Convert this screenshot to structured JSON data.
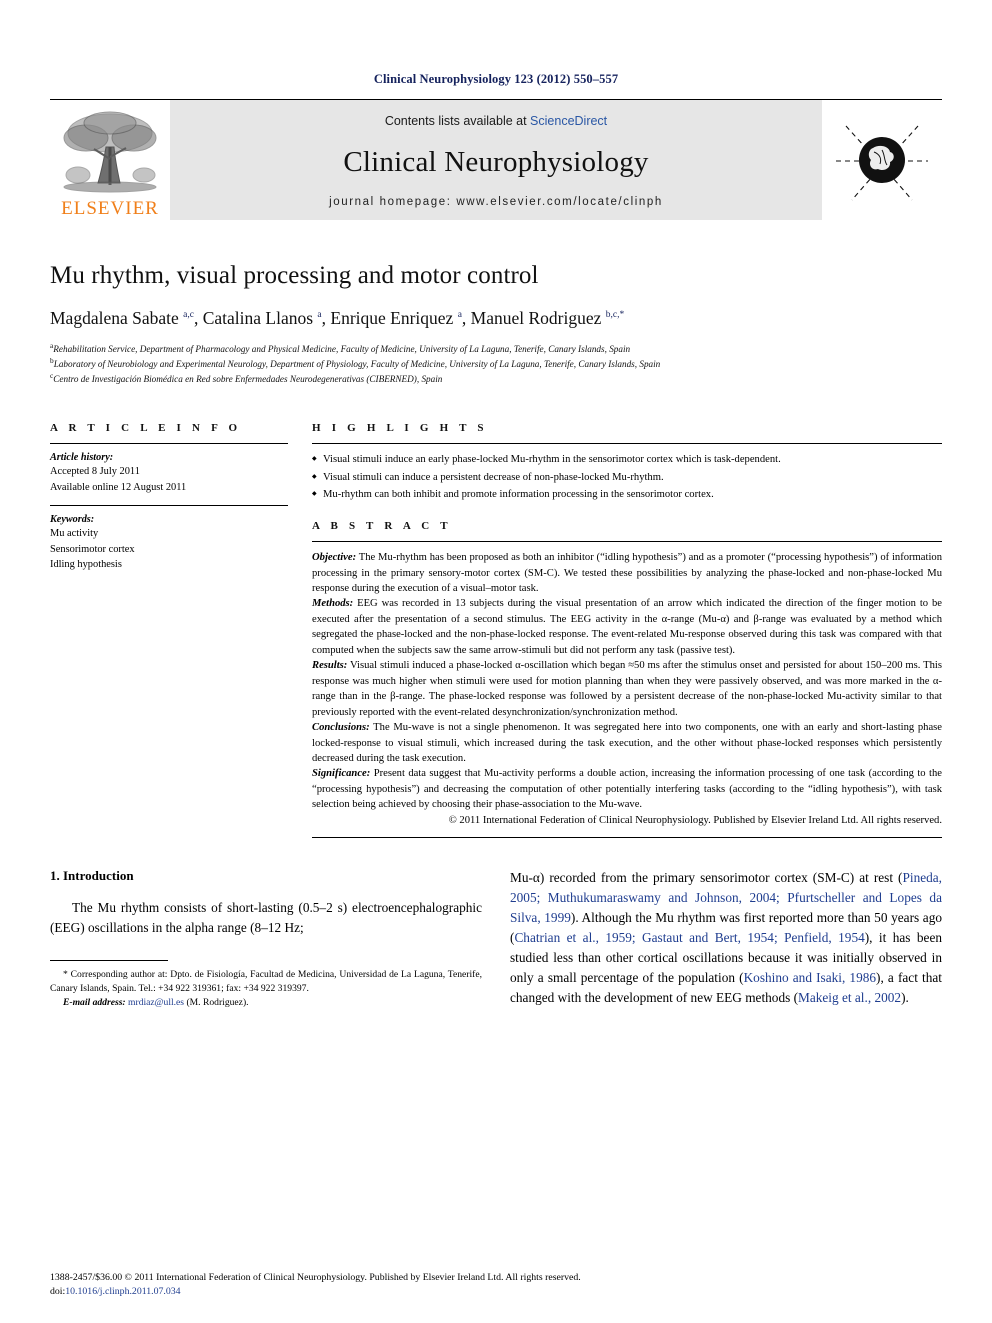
{
  "running_head": "Clinical Neurophysiology 123 (2012) 550–557",
  "masthead": {
    "contents_prefix": "Contents lists available at ",
    "sciencedirect": "ScienceDirect",
    "journal_name": "Clinical Neurophysiology",
    "homepage": "journal homepage: www.elsevier.com/locate/clinph",
    "publisher_wordmark": "ELSEVIER",
    "left_logo_icon": "elsevier-tree-icon",
    "right_logo_icon": "ifcn-brain-globe-icon"
  },
  "article": {
    "title": "Mu rhythm, visual processing and motor control",
    "authors_html": "Magdalena Sabate <sup>a,c</sup>, Catalina Llanos <sup>a</sup>, Enrique Enriquez <sup>a</sup>, Manuel Rodriguez <sup>b,c,*</sup>",
    "affiliations": [
      "Rehabilitation Service, Department of Pharmacology and Physical Medicine, Faculty of Medicine, University of La Laguna, Tenerife, Canary Islands, Spain",
      "Laboratory of Neurobiology and Experimental Neurology, Department of Physiology, Faculty of Medicine, University of La Laguna, Tenerife, Canary Islands, Spain",
      "Centro de Investigación Biomédica en Red sobre Enfermedades Neurodegenerativas (CIBERNED), Spain"
    ],
    "affiliation_marks": [
      "a",
      "b",
      "c"
    ]
  },
  "article_info": {
    "heading": "A R T I C L E   I N F O",
    "history_label": "Article history:",
    "history_lines": [
      "Accepted 8 July 2011",
      "Available online 12 August 2011"
    ],
    "keywords_label": "Keywords:",
    "keywords": [
      "Mu activity",
      "Sensorimotor cortex",
      "Idling hypothesis"
    ]
  },
  "highlights": {
    "heading": "H I G H L I G H T S",
    "items": [
      "Visual stimuli induce an early phase-locked Mu-rhythm in the sensorimotor cortex which is task-dependent.",
      "Visual stimuli can induce a persistent decrease of non-phase-locked Mu-rhythm.",
      "Mu-rhythm can both inhibit and promote information processing in the sensorimotor cortex."
    ]
  },
  "abstract": {
    "heading": "A B S T R A C T",
    "sections": [
      {
        "label": "Objective:",
        "text": " The Mu-rhythm has been proposed as both an inhibitor (“idling hypothesis”) and as a promoter (“processing hypothesis”) of information processing in the primary sensory-motor cortex (SM-C). We tested these possibilities by analyzing the phase-locked and non-phase-locked Mu response during the execution of a visual–motor task."
      },
      {
        "label": "Methods:",
        "text": " EEG was recorded in 13 subjects during the visual presentation of an arrow which indicated the direction of the finger motion to be executed after the presentation of a second stimulus. The EEG activity in the α-range (Mu-α) and β-range was evaluated by a method which segregated the phase-locked and the non-phase-locked response. The event-related Mu-response observed during this task was compared with that computed when the subjects saw the same arrow-stimuli but did not perform any task (passive test)."
      },
      {
        "label": "Results:",
        "text": " Visual stimuli induced a phase-locked α-oscillation which began ≈50 ms after the stimulus onset and persisted for about 150–200 ms. This response was much higher when stimuli were used for motion planning than when they were passively observed, and was more marked in the α-range than in the β-range. The phase-locked response was followed by a persistent decrease of the non-phase-locked Mu-activity similar to that previously reported with the event-related desynchronization/synchronization method."
      },
      {
        "label": "Conclusions:",
        "text": " The Mu-wave is not a single phenomenon. It was segregated here into two components, one with an early and short-lasting phase locked-response to visual stimuli, which increased during the task execution, and the other without phase-locked responses which persistently decreased during the task execution."
      },
      {
        "label": "Significance:",
        "text": " Present data suggest that Mu-activity performs a double action, increasing the information processing of one task (according to the “processing hypothesis”) and decreasing the computation of other potentially interfering tasks (according to the “idling hypothesis”), with task selection being achieved by choosing their phase-association to the Mu-wave."
      }
    ],
    "copyright": "© 2011 International Federation of Clinical Neurophysiology. Published by Elsevier Ireland Ltd. All rights reserved."
  },
  "body": {
    "section_heading": "1. Introduction",
    "left_paragraph": "The Mu rhythm consists of short-lasting (0.5–2 s) electroencephalographic (EEG) oscillations in the alpha range (8–12 Hz;",
    "right_paragraph_part1": "Mu-α) recorded from the primary sensorimotor cortex (SM-C) at rest (",
    "right_cite1": "Pineda, 2005; Muthukumaraswamy and Johnson, 2004; Pfurtscheller and Lopes da Silva, 1999",
    "right_paragraph_part2": "). Although the Mu rhythm was first reported more than 50 years ago (",
    "right_cite2": "Chatrian et al., 1959; Gastaut and Bert, 1954; Penfield, 1954",
    "right_paragraph_part3": "), it has been studied less than other cortical oscillations because it was initially observed in only a small percentage of the population (",
    "right_cite3": "Koshino and Isaki, 1986",
    "right_paragraph_part4": "), a fact that changed with the development of new EEG methods (",
    "right_cite4": "Makeig et al., 2002",
    "right_paragraph_part5": ")."
  },
  "footnote": {
    "marker": "*",
    "text": "Corresponding author at: Dpto. de Fisiología, Facultad de Medicina, Universidad de La Laguna, Tenerife, Canary Islands, Spain. Tel.: +34 922 319361; fax: +34 922 319397.",
    "email_label": "E-mail address:",
    "email": "mrdiaz@ull.es",
    "email_owner": "(M. Rodriguez)."
  },
  "colophon": {
    "issn_line": "1388-2457/$36.00 © 2011 International Federation of Clinical Neurophysiology. Published by Elsevier Ireland Ltd. All rights reserved.",
    "doi_prefix": "doi:",
    "doi": "10.1016/j.clinph.2011.07.034"
  }
}
